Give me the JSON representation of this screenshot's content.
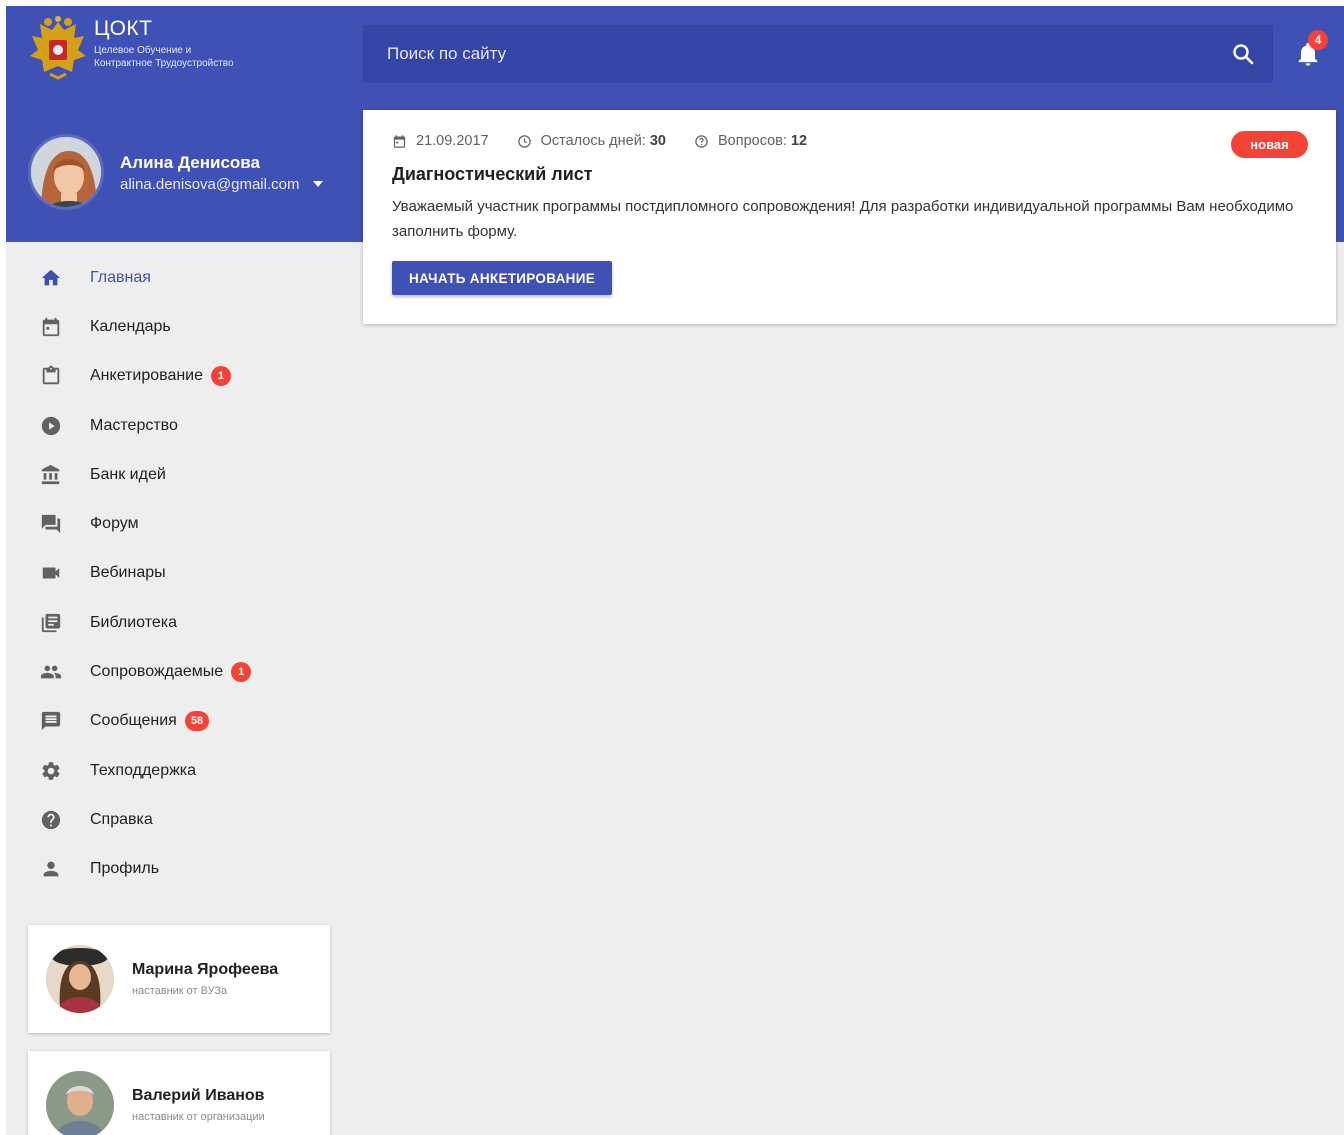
{
  "brand": {
    "title": "ЦОКТ",
    "subtitle_line1": "Целевое Обучение и",
    "subtitle_line2": "Контрактное Трудоустройство"
  },
  "search": {
    "placeholder": "Поиск по сайту",
    "icon": "search-icon"
  },
  "notifications": {
    "count": "4",
    "icon": "bell-icon"
  },
  "user": {
    "name": "Алина Денисова",
    "email": "alina.denisova@gmail.com"
  },
  "nav": {
    "items": [
      {
        "label": "Главная",
        "icon": "home-icon",
        "active": true
      },
      {
        "label": "Календарь",
        "icon": "calendar-icon"
      },
      {
        "label": "Анкетирование",
        "icon": "clipboard-icon",
        "badge": "1"
      },
      {
        "label": "Мастерство",
        "icon": "play-circle-icon"
      },
      {
        "label": "Банк идей",
        "icon": "bank-icon"
      },
      {
        "label": "Форум",
        "icon": "forum-icon"
      },
      {
        "label": "Вебинары",
        "icon": "videocam-icon"
      },
      {
        "label": "Библиотека",
        "icon": "library-icon"
      },
      {
        "label": "Сопровождаемые",
        "icon": "people-icon",
        "badge": "1"
      },
      {
        "label": "Сообщения",
        "icon": "message-icon",
        "badge": "58"
      },
      {
        "label": "Техподдержка",
        "icon": "settings-icon"
      },
      {
        "label": "Справка",
        "icon": "help-icon"
      },
      {
        "label": "Профиль",
        "icon": "person-icon"
      }
    ]
  },
  "mentors": [
    {
      "name": "Марина Ярофеева",
      "role": "наставник от ВУЗа"
    },
    {
      "name": "Валерий Иванов",
      "role": "наставник от организации"
    }
  ],
  "card": {
    "date": "21.09.2017",
    "days_label": "Осталось дней:",
    "days_value": "30",
    "questions_label": "Вопросов:",
    "questions_value": "12",
    "status": "новая",
    "title": "Диагностический лист",
    "text": "Уважаемый участник программы постдипломного сопровождения! Для разработки индивидуальной программы Вам необходимо заполнить форму.",
    "button": "НАЧАТЬ АНКЕТИРОВАНИЕ"
  },
  "colors": {
    "primary": "#3f51b5",
    "badge": "#f44336",
    "background": "#eeeeee"
  }
}
